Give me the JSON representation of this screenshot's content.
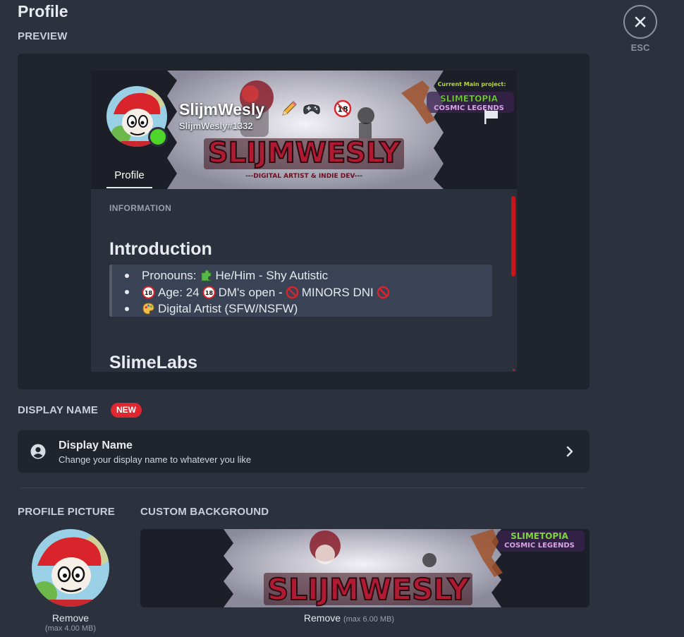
{
  "page": {
    "title": "Profile",
    "close_label": "ESC"
  },
  "preview": {
    "label": "PREVIEW",
    "username": "SlijmWesly",
    "handle": "SlijmWesly#1332",
    "tab_label": "Profile",
    "banner_project_label": "Current Main project:",
    "banner_project_title1": "SLIMETOPIA",
    "banner_project_title2": "COSMIC LEGENDS",
    "banner_name": "SLIJMWESLY",
    "banner_tagline": "---DIGITAL ARTIST & INDIE DEV---",
    "info_label": "INFORMATION",
    "intro_title": "Introduction",
    "intro_items": [
      {
        "pre": "Pronouns: ",
        "post": " He/Him - Shy Autistic"
      },
      {
        "pre": "",
        "mid1": " Age: 24 ",
        "mid2": " DM's open - ",
        "post": "MINORS DNI"
      },
      {
        "pre": "",
        "post": " Digital Artist (SFW/NSFW)"
      }
    ],
    "section2_title": "SlimeLabs",
    "status_color": "#4fd62a",
    "scrollbar_color": "#c8141a"
  },
  "display_name": {
    "label": "DISPLAY NAME",
    "badge": "NEW",
    "row_title": "Display Name",
    "row_subtitle": "Change your display name to whatever you like"
  },
  "profile_picture": {
    "label": "PROFILE PICTURE",
    "remove": "Remove",
    "max": "(max 4.00 MB)"
  },
  "custom_background": {
    "label": "CUSTOM BACKGROUND",
    "remove": "Remove",
    "max": "(max 6.00 MB)"
  },
  "icons": {
    "close": "close-icon",
    "user": "user-circle-icon",
    "chevron": "chevron-right-icon",
    "flag": "flag-icon",
    "pencil": "pencil-icon",
    "gamepad": "gamepad-icon",
    "eighteen": "18-plus-icon",
    "puzzle": "puzzle-icon",
    "no_entry": "no-entry-icon",
    "palette": "palette-icon"
  },
  "colors": {
    "background": "#2b313d",
    "panel": "#1f242d",
    "badge": "#e02730"
  }
}
